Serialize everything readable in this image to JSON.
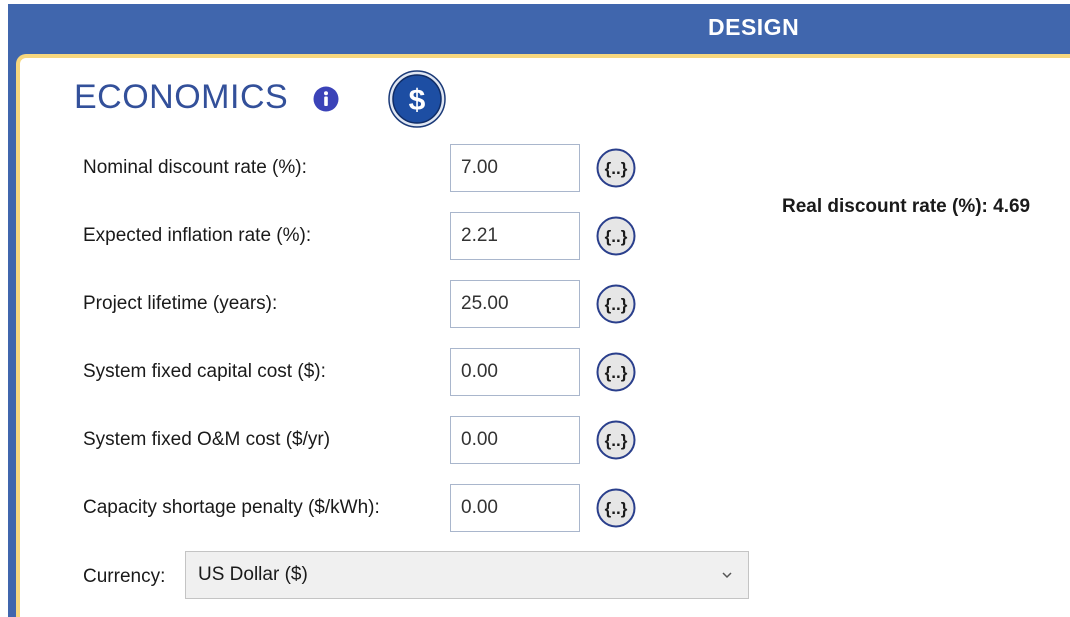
{
  "header": {
    "title": "DESIGN"
  },
  "section": {
    "title": "ECONOMICS",
    "info_icon": "info-icon",
    "section_icon": "dollar-icon"
  },
  "fields": [
    {
      "label": "Nominal discount rate (%):",
      "value": "7.00"
    },
    {
      "label": "Expected inflation rate (%):",
      "value": "2.21"
    },
    {
      "label": "Project lifetime (years):",
      "value": "25.00"
    },
    {
      "label": "System fixed capital cost ($):",
      "value": "0.00"
    },
    {
      "label": "System fixed O&M cost ($/yr)",
      "value": "0.00"
    },
    {
      "label": "Capacity shortage penalty ($/kWh):",
      "value": "0.00"
    }
  ],
  "sensitivity_button": {
    "label": "{..}",
    "icon": "sensitivity-brace-icon"
  },
  "real_discount": {
    "text": "Real discount rate (%): 4.69"
  },
  "currency": {
    "label": "Currency:",
    "selected": "US Dollar ($)"
  },
  "colors": {
    "header_blue": "#4066ad",
    "title_blue": "#33509a",
    "panel_border": "#f7d77e"
  }
}
